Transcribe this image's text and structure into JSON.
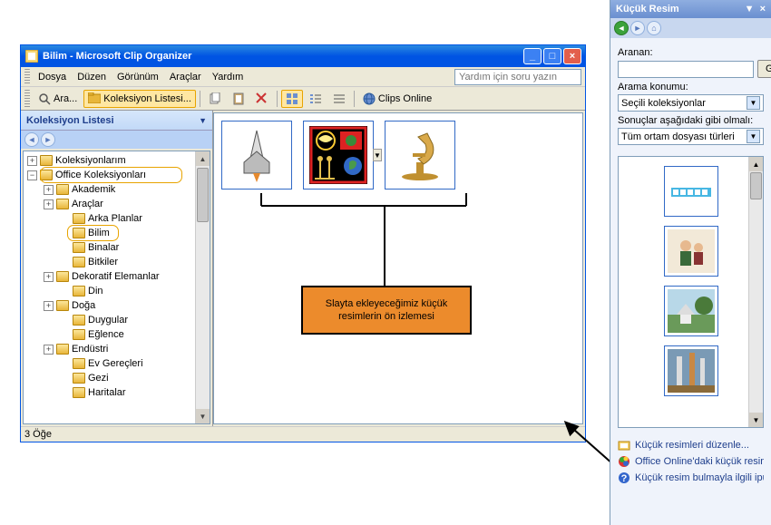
{
  "window": {
    "title": "Bilim - Microsoft Clip Organizer"
  },
  "menubar": {
    "file": "Dosya",
    "edit": "Düzen",
    "view": "Görünüm",
    "tools": "Araçlar",
    "help": "Yardım",
    "help_placeholder": "Yardım için soru yazın"
  },
  "toolbar": {
    "search": "Ara...",
    "collection_list": "Koleksiyon Listesi...",
    "clips_online": "Clips Online"
  },
  "side": {
    "title": "Koleksiyon Listesi"
  },
  "tree": {
    "my_collections": "Koleksiyonlarım",
    "office_collections": "Office Koleksiyonları",
    "items": {
      "akademik": "Akademik",
      "araclar": "Araçlar",
      "arka_planlar": "Arka Planlar",
      "bilim": "Bilim",
      "binalar": "Binalar",
      "bitkiler": "Bitkiler",
      "dekoratif": "Dekoratif Elemanlar",
      "din": "Din",
      "doga": "Doğa",
      "duygular": "Duygular",
      "eglence": "Eğlence",
      "endustri": "Endüstri",
      "ev_gerecleri": "Ev Gereçleri",
      "gezi": "Gezi",
      "haritalar": "Haritalar"
    }
  },
  "annotation": {
    "text": "Slayta ekleyeceğimiz küçük resimlerin ön izlemesi"
  },
  "status": {
    "text": "3 Öğe"
  },
  "taskpane": {
    "title": "Küçük Resim",
    "search_label": "Aranan:",
    "go_btn": "Git",
    "location_label": "Arama konumu:",
    "location_value": "Seçili koleksiyonlar",
    "results_label": "Sonuçlar aşağıdaki gibi olmalı:",
    "results_value": "Tüm ortam dosyası türleri",
    "link_organize": "Küçük resimleri düzenle...",
    "link_office_online": "Office Online'daki küçük resimler",
    "link_tips": "Küçük resim bulmayla ilgili ipuçları"
  }
}
